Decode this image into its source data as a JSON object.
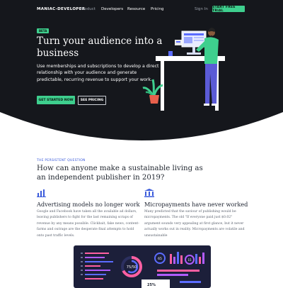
{
  "nav": {
    "logo": "MANIAC-DEVELOPER",
    "links": [
      "Product",
      "Developers",
      "Resource",
      "Pricing"
    ],
    "signin": "Sign In",
    "cta": "START FREE TRIAL"
  },
  "hero": {
    "badge": "BETA",
    "title": "Turn your audience into a business",
    "description": "Use memberships and subscriptions to develop a direct relationship with your audience and generate predictable, recurring revenue to support your work.",
    "primary_button": "GET STARTED NOW",
    "secondary_button": "SEE PRICING"
  },
  "section": {
    "eyebrow": "THE PERSISTENT QUESTION",
    "title": "How can anyone make a sustainable living as an independent publisher in 2019?"
  },
  "features": [
    {
      "icon": "bar-chart-icon",
      "title": "Advertising models no longer work",
      "text": "Google and Facebook have taken all the available ad dollars, leaving publishers to fight for the last remaining scraps of revenue by any means possible. Clickbait, fake news, content-farms and outrage are the desperate final attempts to hold onto past traffic levels."
    },
    {
      "icon": "bank-icon",
      "title": "Micropayments have never worked",
      "text": "Many predicted that the saviour of publishing would be micropayments. The old \"If everyone paid just $0.02\" argument sounds very appealing at first glance, but it never actually works out in reality. Micropayments are volatile and unsustainable"
    }
  ],
  "dashboard": {
    "gauge_label": "75/50",
    "stat_label": "65",
    "stat_label_2": "15",
    "percent_label": "25%"
  },
  "colors": {
    "hero_bg": "#15171c",
    "accent_green": "#3ecf8e",
    "eyebrow_blue": "#3b5bdb",
    "person_shirt": "#3ecf8e",
    "person_pants": "#5b5bd6"
  }
}
